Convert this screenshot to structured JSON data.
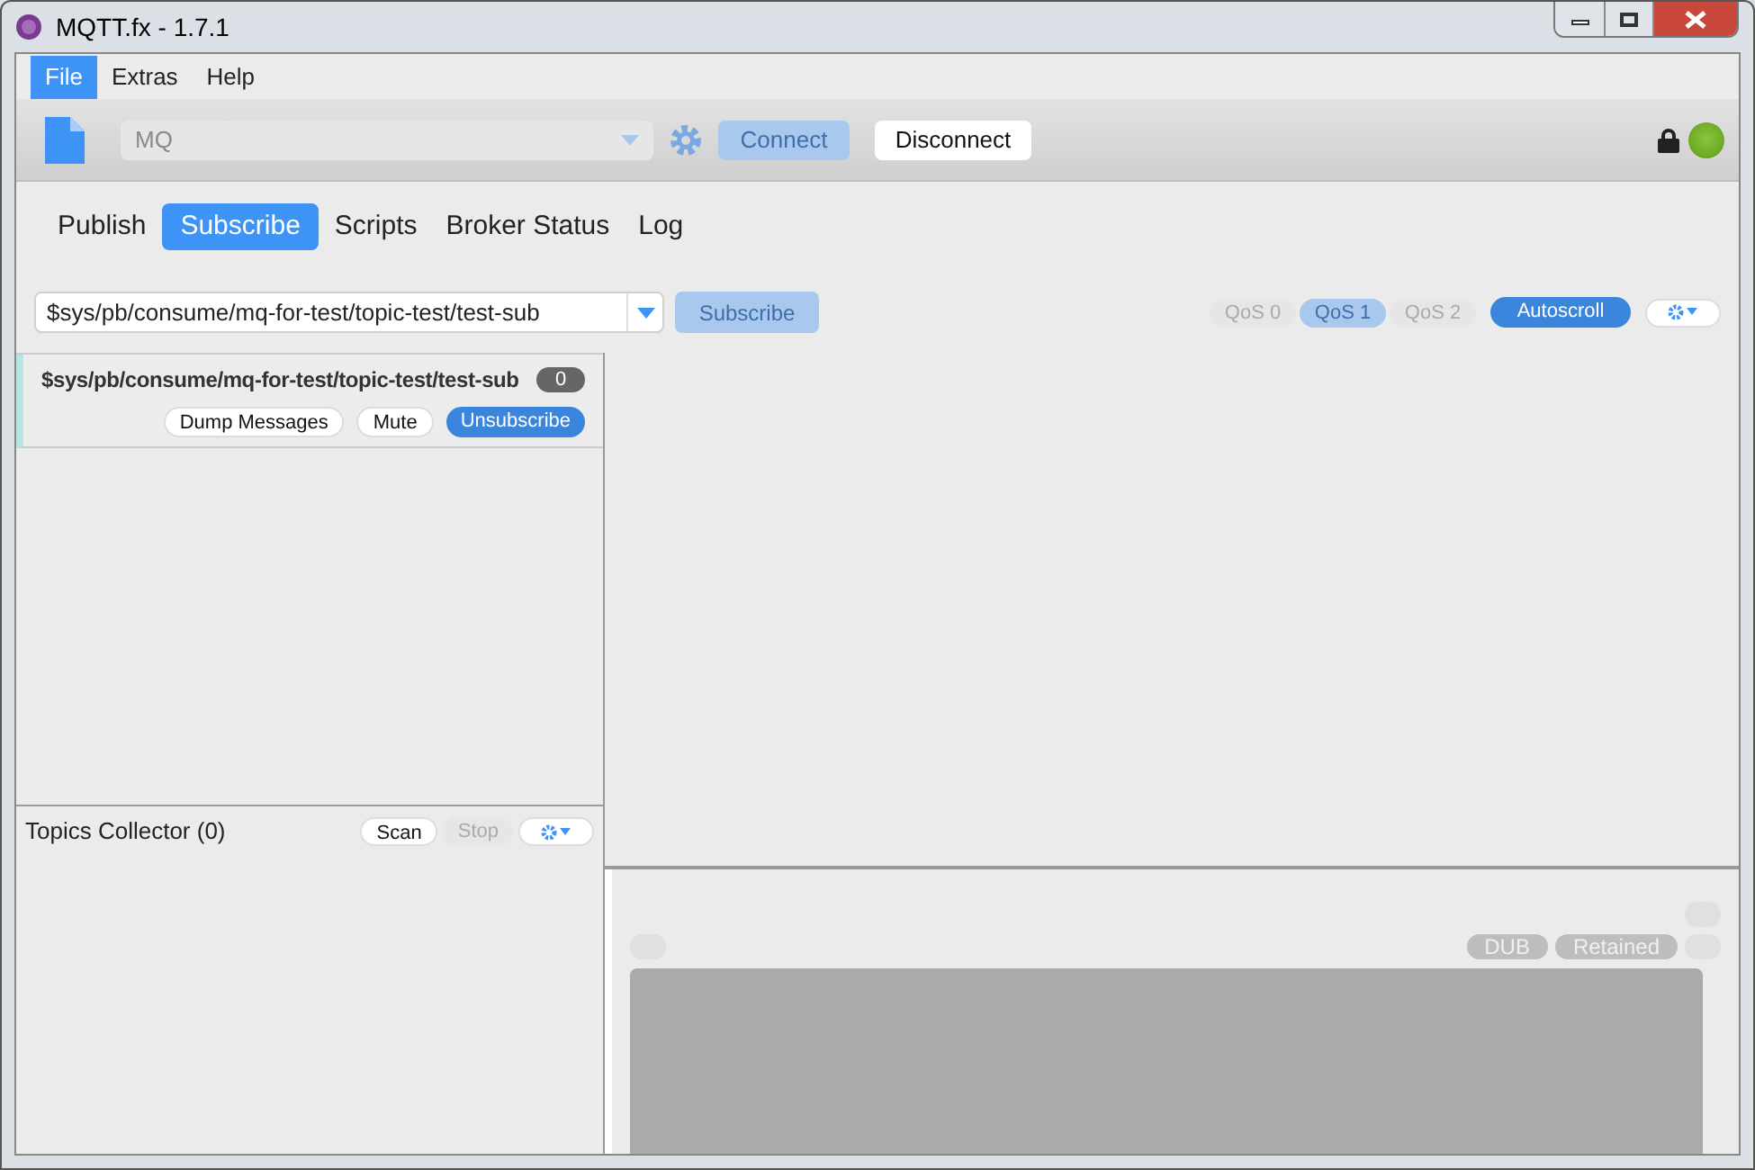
{
  "window": {
    "title": "MQTT.fx - 1.7.1"
  },
  "menu": [
    {
      "label": "File",
      "selected": true
    },
    {
      "label": "Extras",
      "selected": false
    },
    {
      "label": "Help",
      "selected": false
    }
  ],
  "connection": {
    "profile": "MQ",
    "connect": {
      "label": "Connect",
      "disabled": true
    },
    "disconnect": {
      "label": "Disconnect",
      "disabled": false
    },
    "locked": true,
    "connected": true
  },
  "tabs": [
    {
      "label": "Publish",
      "selected": false
    },
    {
      "label": "Subscribe",
      "selected": true
    },
    {
      "label": "Scripts",
      "selected": false
    },
    {
      "label": "Broker Status",
      "selected": false
    },
    {
      "label": "Log",
      "selected": false
    }
  ],
  "subscribe": {
    "topic": "$sys/pb/consume/mq-for-test/topic-test/test-sub",
    "button": {
      "label": "Subscribe",
      "disabled": true
    },
    "qos": [
      {
        "label": "QoS 0",
        "selected": false
      },
      {
        "label": "QoS 1",
        "selected": true
      },
      {
        "label": "QoS 2",
        "selected": false
      }
    ],
    "autoscroll": {
      "label": "Autoscroll",
      "on": true
    }
  },
  "subscriptions": [
    {
      "topic": "$sys/pb/consume/mq-for-test/topic-test/test-sub",
      "count": "0",
      "selected": true,
      "buttons": [
        {
          "label": "Dump Messages",
          "kind": "plain"
        },
        {
          "label": "Mute",
          "kind": "plain"
        },
        {
          "label": "Unsubscribe",
          "kind": "primary"
        }
      ]
    }
  ],
  "topics_collector": {
    "title": "Topics Collector (0)",
    "buttons": [
      {
        "label": "Scan",
        "disabled": false
      },
      {
        "label": "Stop",
        "disabled": true
      }
    ]
  },
  "message_detail": {
    "flags": [
      {
        "label": "DUB"
      },
      {
        "label": "Retained"
      }
    ]
  }
}
